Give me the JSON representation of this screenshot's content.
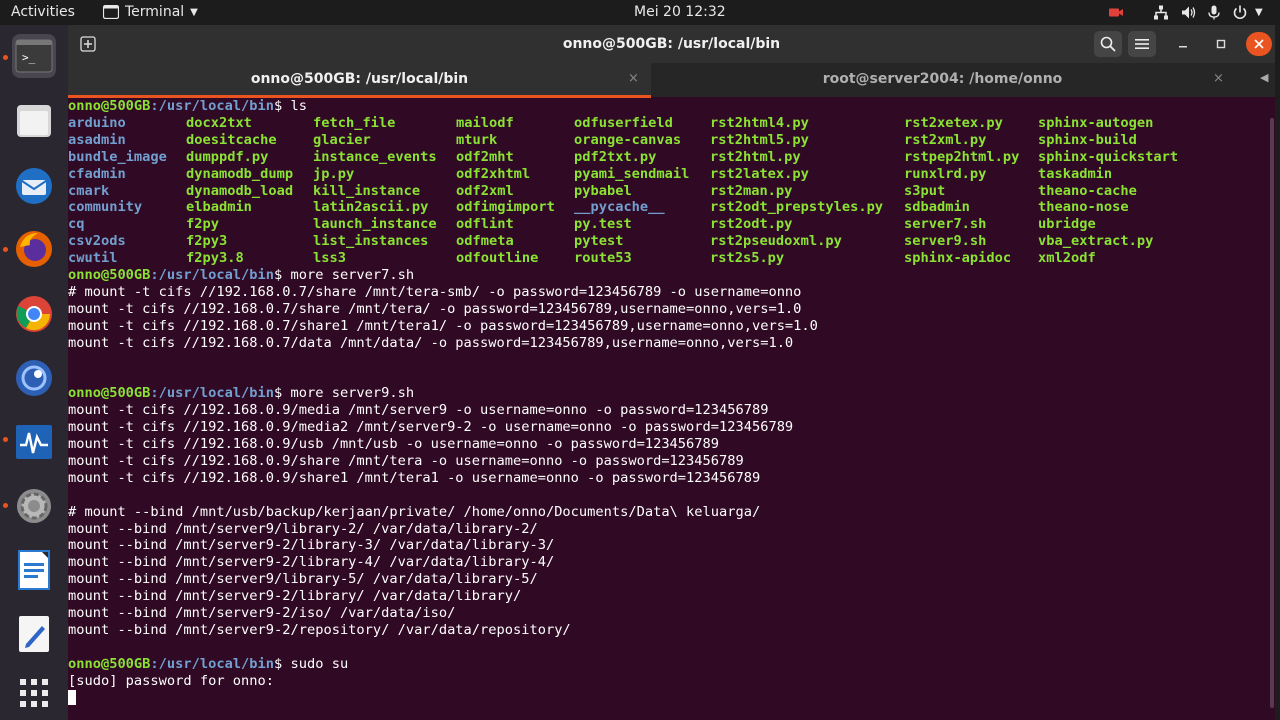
{
  "topbar": {
    "activities": "Activities",
    "app_menu": "Terminal",
    "clock": "Mei 20  12:32"
  },
  "window": {
    "title": "onno@500GB: /usr/local/bin"
  },
  "tabs": [
    {
      "label": "onno@500GB: /usr/local/bin",
      "close": "×"
    },
    {
      "label": "root@server2004: /home/onno",
      "close": "×"
    }
  ],
  "terminal": {
    "prompt_user": "onno@500GB",
    "prompt_path": ":/usr/local/bin",
    "cmd_ls": "$ ls",
    "ls_columns": [
      [
        "arduino",
        "asadmin",
        "bundle_image",
        "cfadmin",
        "cmark",
        "community",
        "cq",
        "csv2ods",
        "cwutil"
      ],
      [
        "docx2txt",
        "doesitcache",
        "dumppdf.py",
        "dynamodb_dump",
        "dynamodb_load",
        "elbadmin",
        "f2py",
        "f2py3",
        "f2py3.8"
      ],
      [
        "fetch_file",
        "glacier",
        "instance_events",
        "jp.py",
        "kill_instance",
        "latin2ascii.py",
        "launch_instance",
        "list_instances",
        "lss3"
      ],
      [
        "mailodf",
        "mturk",
        "odf2mht",
        "odf2xhtml",
        "odf2xml",
        "odfimgimport",
        "odflint",
        "odfmeta",
        "odfoutline"
      ],
      [
        "odfuserfield",
        "orange-canvas",
        "pdf2txt.py",
        "pyami_sendmail",
        "pybabel",
        "__pycache__",
        "py.test",
        "pytest",
        "route53"
      ],
      [
        "rst2html4.py",
        "rst2html5.py",
        "rst2html.py",
        "rst2latex.py",
        "rst2man.py",
        "rst2odt_prepstyles.py",
        "rst2odt.py",
        "rst2pseudoxml.py",
        "rst2s5.py"
      ],
      [
        "rst2xetex.py",
        "rst2xml.py",
        "rstpep2html.py",
        "runxlrd.py",
        "s3put",
        "sdbadmin",
        "server7.sh",
        "server9.sh",
        "sphinx-apidoc"
      ],
      [
        "sphinx-autogen",
        "sphinx-build",
        "sphinx-quickstart",
        "taskadmin",
        "theano-cache",
        "theano-nose",
        "ubridge",
        "vba_extract.py",
        "xml2odf"
      ]
    ],
    "cmd_server7": "$ more server7.sh",
    "server7_lines": [
      "# mount -t cifs //192.168.0.7/share /mnt/tera-smb/ -o password=123456789 -o username=onno",
      "mount -t cifs //192.168.0.7/share /mnt/tera/ -o password=123456789,username=onno,vers=1.0",
      "mount -t cifs //192.168.0.7/share1 /mnt/tera1/ -o password=123456789,username=onno,vers=1.0",
      "mount -t cifs //192.168.0.7/data /mnt/data/ -o password=123456789,username=onno,vers=1.0"
    ],
    "cmd_server9": "$ more server9.sh",
    "server9_lines": [
      "mount -t cifs //192.168.0.9/media /mnt/server9 -o username=onno -o password=123456789",
      "mount -t cifs //192.168.0.9/media2 /mnt/server9-2 -o username=onno -o password=123456789",
      "mount -t cifs //192.168.0.9/usb /mnt/usb -o username=onno -o password=123456789",
      "mount -t cifs //192.168.0.9/share /mnt/tera -o username=onno -o password=123456789",
      "mount -t cifs //192.168.0.9/share1 /mnt/tera1 -o username=onno -o password=123456789",
      "",
      "# mount --bind /mnt/usb/backup/kerjaan/private/ /home/onno/Documents/Data\\ keluarga/",
      "mount --bind /mnt/server9/library-2/ /var/data/library-2/",
      "mount --bind /mnt/server9-2/library-3/ /var/data/library-3/",
      "mount --bind /mnt/server9-2/library-4/ /var/data/library-4/",
      "mount --bind /mnt/server9/library-5/ /var/data/library-5/",
      "mount --bind /mnt/server9-2/library/ /var/data/library/",
      "mount --bind /mnt/server9-2/iso/ /var/data/iso/",
      "mount --bind /mnt/server9-2/repository/ /var/data/repository/"
    ],
    "cmd_sudo": "$ sudo su",
    "sudo_prompt": "[sudo] password for onno:"
  },
  "colors": {
    "terminal_bg": "#300a24",
    "prompt_green": "#8ae234",
    "prompt_blue": "#729fcf",
    "accent": "#e95420"
  }
}
